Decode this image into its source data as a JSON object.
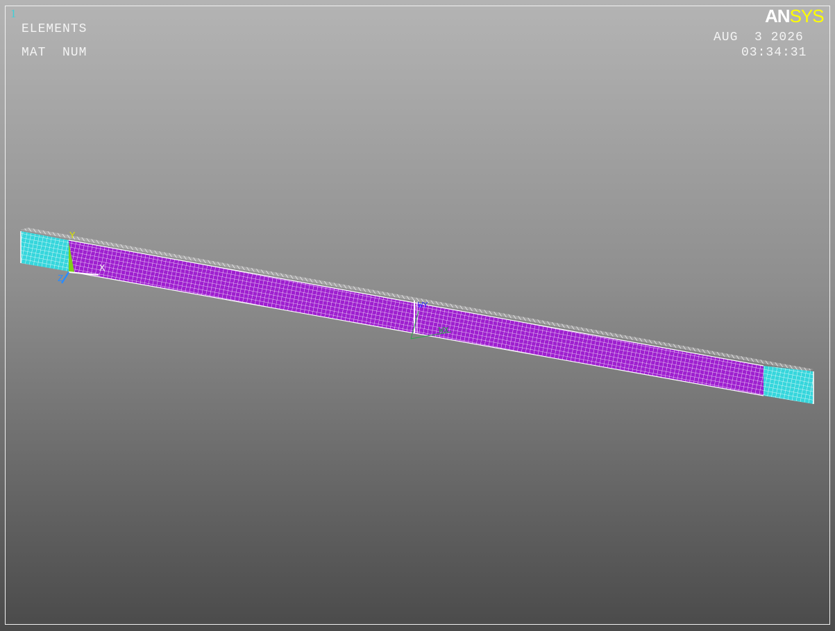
{
  "window_number": "1",
  "plot_labels": {
    "line1": "ELEMENTS",
    "line2": "MAT  NUM"
  },
  "logo": {
    "part1": "AN",
    "part2": "SYS"
  },
  "datetime": {
    "date": "AUG  3 2026",
    "time": "03:34:31"
  },
  "triad": {
    "x_label": "X",
    "y_label": "Y",
    "z_label": "Z"
  },
  "wp_marker": {
    "label1": "WY",
    "label2": "WX"
  },
  "colors": {
    "mat1": "#36d6dc",
    "mat2": "#9e1fcf",
    "mesh_line": "#ffffff",
    "logo_white": "#ffffff",
    "logo_yellow": "#ffff00"
  }
}
